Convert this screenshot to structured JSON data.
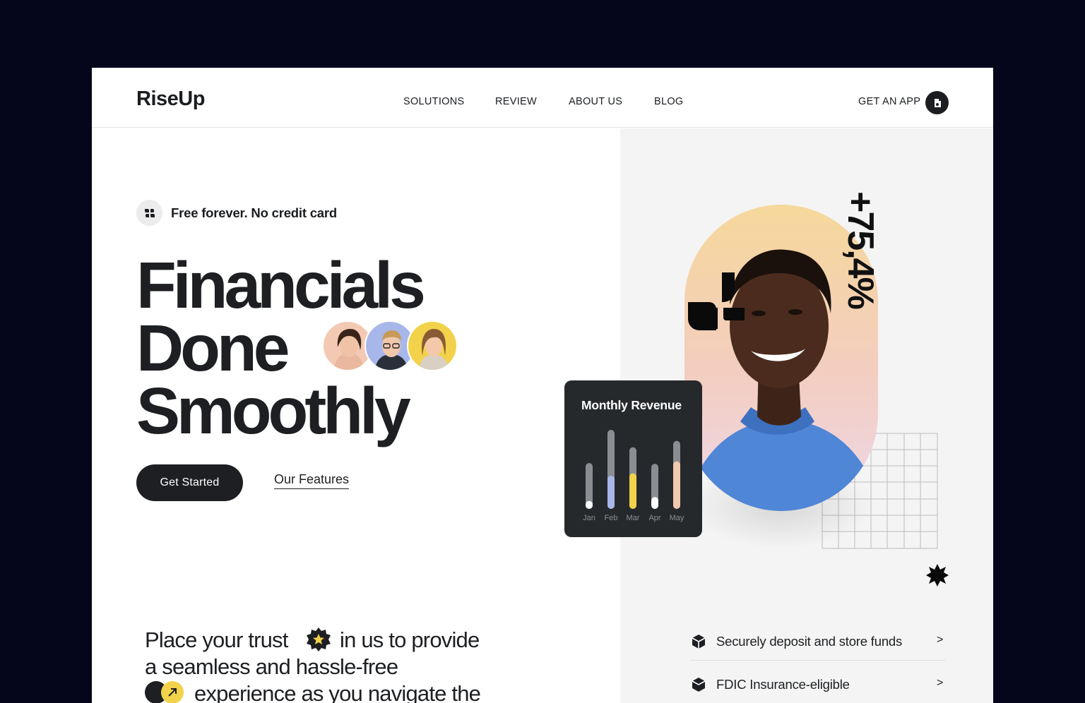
{
  "brand": {
    "logo": "RiseUp"
  },
  "nav": {
    "items": [
      "SOLUTIONS",
      "REVIEW",
      "ABOUT US",
      "BLOG"
    ],
    "get_app": "GET AN APP"
  },
  "hero": {
    "badge": "Free forever. No credit card",
    "headline": [
      "Financials",
      "Done",
      "Smoothly"
    ],
    "primary_cta": "Get Started",
    "secondary_cta": "Our Features",
    "trust_lines": [
      "Place your trust",
      "in us to provide",
      "a seamless and hassle-free",
      "experience as you navigate the"
    ]
  },
  "revenue_card": {
    "title": "Monthly Revenue",
    "chart_data": {
      "type": "bar",
      "categories": [
        "Jan",
        "Feb",
        "Mar",
        "Apr",
        "May"
      ],
      "values": [
        0.1,
        0.42,
        0.45,
        0.15,
        0.6
      ],
      "track": [
        0.58,
        1.0,
        0.78,
        0.57,
        0.86
      ],
      "colors": [
        "#ffffff",
        "#a7b7ea",
        "#f2d24a",
        "#ffffff",
        "#f3c9ae"
      ]
    }
  },
  "stat": {
    "value": "+75,4%"
  },
  "features": [
    {
      "label": "Securely deposit and store funds",
      "chevron": ">"
    },
    {
      "label": "FDIC Insurance-eligible",
      "chevron": ">"
    }
  ],
  "colors": {
    "dark": "#1d1f22",
    "background": "#05061c",
    "panel": "#f4f4f4",
    "accent_yellow": "#f2d24a"
  }
}
